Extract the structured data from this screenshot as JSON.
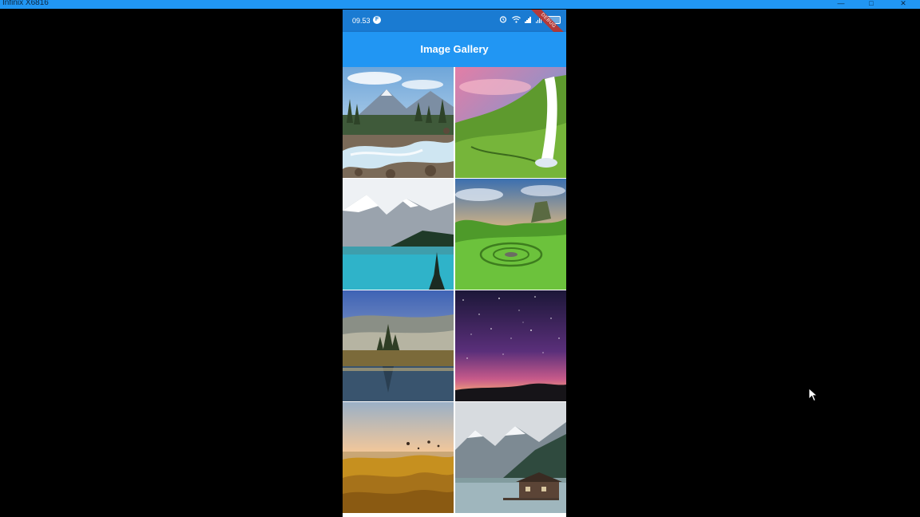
{
  "window": {
    "title": "Infinix X6816"
  },
  "status_bar": {
    "time": "09.53",
    "notification_icon": "F"
  },
  "debug_banner": {
    "label": "DEBUG"
  },
  "app_bar": {
    "title": "Image Gallery"
  },
  "gallery": {
    "items": [
      {
        "name": "mountain-river-photo"
      },
      {
        "name": "waterfall-photo"
      },
      {
        "name": "lake-mountains-photo"
      },
      {
        "name": "green-valley-photo"
      },
      {
        "name": "misty-forest-lake-photo"
      },
      {
        "name": "starry-sky-photo"
      },
      {
        "name": "hot-air-balloons-photo"
      },
      {
        "name": "mountain-lake-cabin-photo"
      }
    ]
  }
}
